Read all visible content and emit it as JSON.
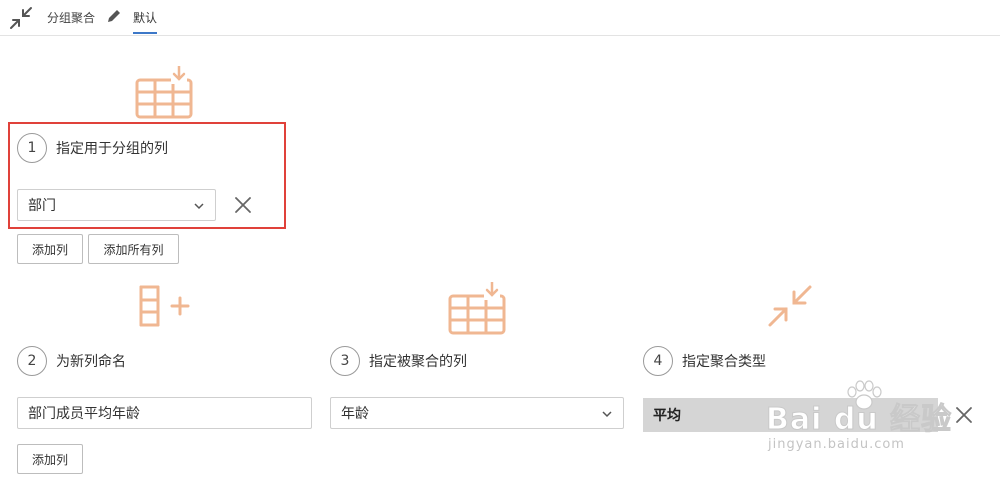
{
  "topbar": {
    "collapse_icon": "collapse-arrows-icon",
    "title": "分组聚合",
    "edit_icon": "pencil-icon",
    "active_tab": "默认",
    "accent_color": "#3d78c8"
  },
  "icon_color": "#f0b792",
  "group_by": {
    "icon": "table-import-icon",
    "step_number": "1",
    "step_label": "指定用于分组的列",
    "column_select": {
      "value": "部门"
    },
    "remove_icon": "close-icon",
    "add_column_button": "添加列",
    "add_all_columns_button": "添加所有列"
  },
  "new_column": {
    "icon": "add-column-icon",
    "step_number": "2",
    "step_label": "为新列命名",
    "name_input": {
      "value": "部门成员平均年龄"
    },
    "add_column_button": "添加列"
  },
  "aggregated_column": {
    "icon": "table-import-icon",
    "step_number": "3",
    "step_label": "指定被聚合的列",
    "column_select": {
      "value": "年龄"
    }
  },
  "aggregation_type": {
    "icon": "collapse-arrows-icon",
    "step_number": "4",
    "step_label": "指定聚合类型",
    "type_value": "平均",
    "remove_icon": "close-icon"
  },
  "watermark": {
    "brand": "Bai du 经验",
    "url": "jingyan.baidu.com"
  },
  "highlight_color": "#e0413a"
}
